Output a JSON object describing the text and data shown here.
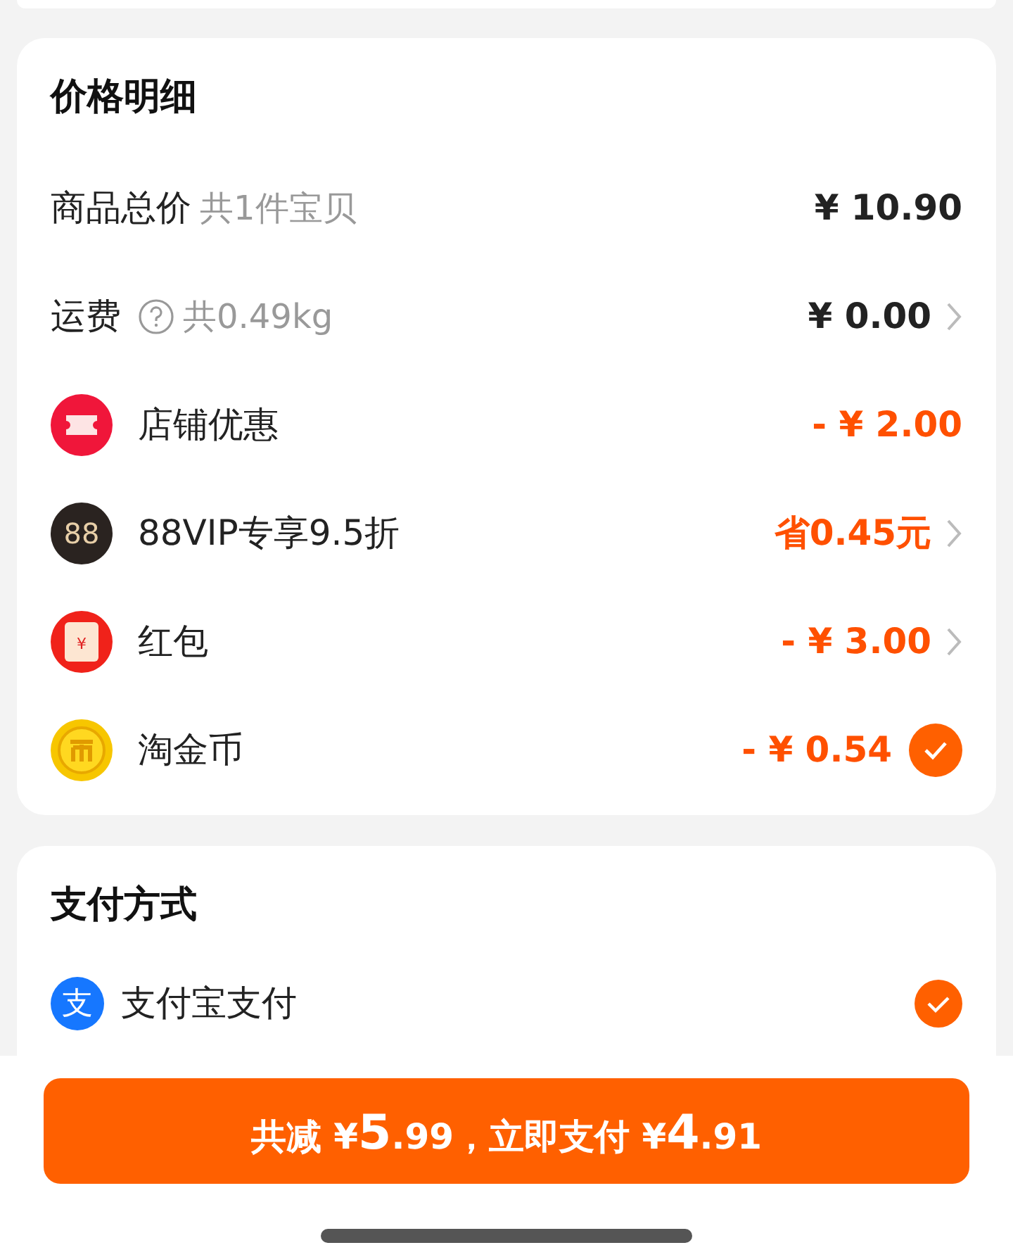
{
  "price_detail": {
    "title": "价格明细",
    "rows": [
      {
        "kind": "plain",
        "label": "商品总价",
        "note": "共1件宝贝",
        "value": "¥ 10.90",
        "discount": false,
        "chevron": false,
        "checked": false
      },
      {
        "kind": "help",
        "label": "运费",
        "note": "共0.49kg",
        "value": "¥ 0.00",
        "discount": false,
        "chevron": true,
        "checked": false
      },
      {
        "kind": "ticket",
        "label": "店铺优惠",
        "value": "- ¥ 2.00",
        "discount": true,
        "chevron": false,
        "checked": false
      },
      {
        "kind": "vip",
        "icon_text": "88",
        "label": "88VIP专享9.5折",
        "value": "省0.45元",
        "discount": true,
        "chevron": true,
        "checked": false
      },
      {
        "kind": "packet",
        "icon_text": "¥",
        "label": "红包",
        "value": "- ¥ 3.00",
        "discount": true,
        "chevron": true,
        "checked": false
      },
      {
        "kind": "coin",
        "label": "淘金币",
        "value": "- ¥ 0.54",
        "discount": true,
        "chevron": false,
        "checked": true
      }
    ]
  },
  "payment": {
    "title": "支付方式",
    "methods": [
      {
        "icon_text": "支",
        "label": "支付宝支付",
        "selected": true
      }
    ]
  },
  "pay_button": {
    "segments": [
      {
        "text": "共减 ¥",
        "big": false
      },
      {
        "text": "5",
        "big": true
      },
      {
        "text": ".99，立即支付 ¥",
        "big": false
      },
      {
        "text": "4",
        "big": true
      },
      {
        "text": ".91",
        "big": false
      }
    ]
  }
}
